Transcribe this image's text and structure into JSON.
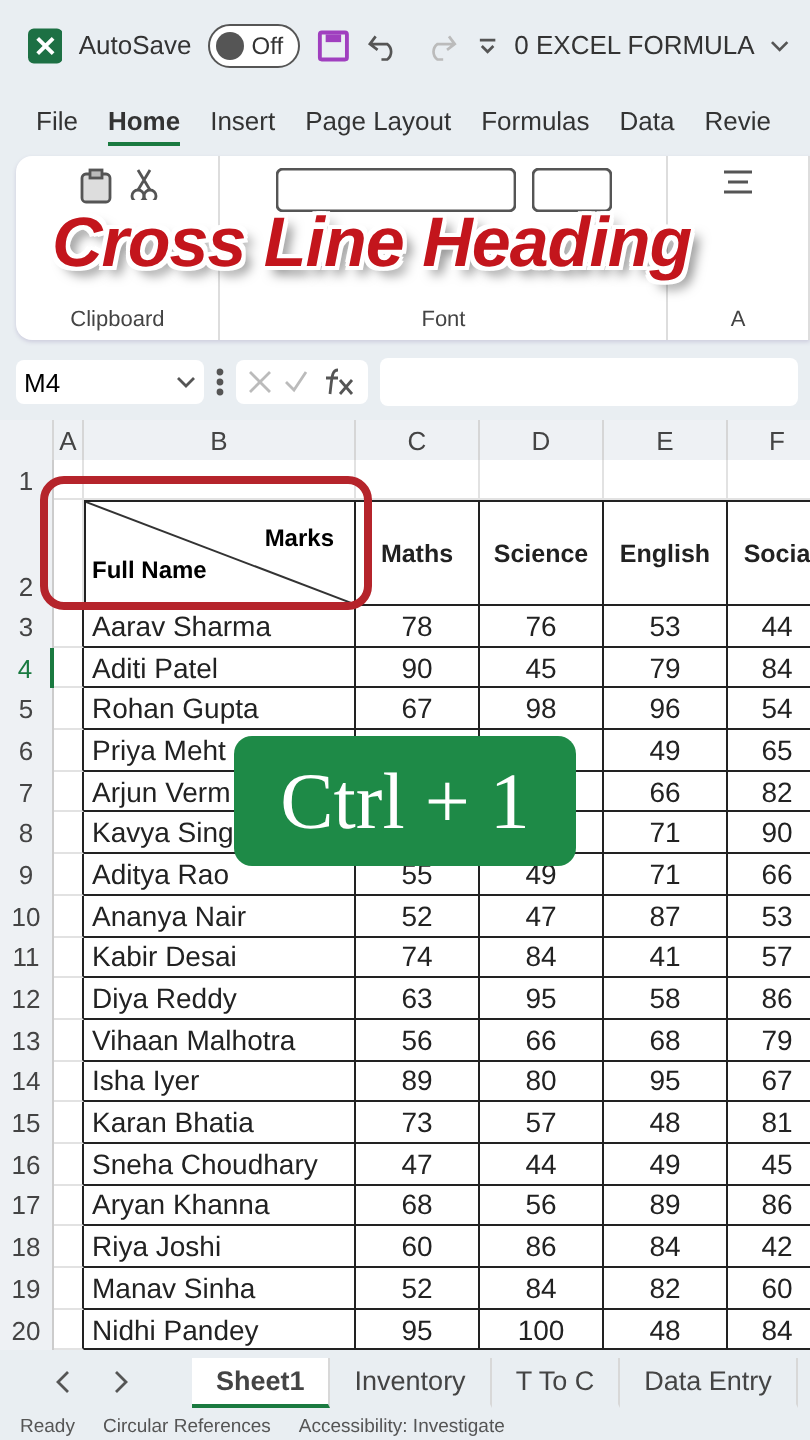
{
  "title_bar": {
    "autosave_label": "AutoSave",
    "autosave": {
      "on": false,
      "label": "Off"
    },
    "document_title": "0 EXCEL FORMULA"
  },
  "ribbon_tabs": [
    {
      "label": "File",
      "selected": false
    },
    {
      "label": "Home",
      "selected": true
    },
    {
      "label": "Insert",
      "selected": false
    },
    {
      "label": "Page Layout",
      "selected": false
    },
    {
      "label": "Formulas",
      "selected": false
    },
    {
      "label": "Data",
      "selected": false
    },
    {
      "label": "Revie",
      "selected": false
    }
  ],
  "ribbon_groups": [
    {
      "kind": "clipboard",
      "label": "Clipboard"
    },
    {
      "kind": "font",
      "label": "Font"
    },
    {
      "kind": "alignment",
      "label": "A"
    }
  ],
  "overlay_title": "Cross Line Heading",
  "formula_bar": {
    "name_box": "M4"
  },
  "sheet": {
    "columns": [
      "A",
      "B",
      "C",
      "D",
      "E",
      "F"
    ],
    "blank_row": {
      "number": "1"
    },
    "header_row": {
      "number": "2",
      "diagonal_top": "Marks",
      "diagonal_bottom": "Full Name",
      "subjects": [
        "Maths",
        "Science",
        "English",
        "Socia"
      ]
    },
    "rows": [
      {
        "number": "3",
        "selected": false,
        "name": "Aarav Sharma",
        "marks": [
          "78",
          "76",
          "53",
          "44"
        ]
      },
      {
        "number": "4",
        "selected": true,
        "name": "Aditi Patel",
        "marks": [
          "90",
          "45",
          "79",
          "84"
        ]
      },
      {
        "number": "5",
        "selected": false,
        "name": "Rohan Gupta",
        "marks": [
          "67",
          "98",
          "96",
          "54"
        ]
      },
      {
        "number": "6",
        "selected": false,
        "name": "Priya Meht",
        "marks": [
          "49",
          "65"
        ]
      },
      {
        "number": "7",
        "selected": false,
        "name": "Arjun Verm",
        "marks": [
          "66",
          "82"
        ]
      },
      {
        "number": "8",
        "selected": false,
        "name": "Kavya Sing",
        "marks": [
          "71",
          "90"
        ]
      },
      {
        "number": "9",
        "selected": false,
        "name": "Aditya Rao",
        "marks": [
          "55",
          "49",
          "71",
          "66"
        ]
      },
      {
        "number": "10",
        "selected": false,
        "name": "Ananya Nair",
        "marks": [
          "52",
          "47",
          "87",
          "53"
        ]
      },
      {
        "number": "11",
        "selected": false,
        "name": "Kabir Desai",
        "marks": [
          "74",
          "84",
          "41",
          "57"
        ]
      },
      {
        "number": "12",
        "selected": false,
        "name": "Diya Reddy",
        "marks": [
          "63",
          "95",
          "58",
          "86"
        ]
      },
      {
        "number": "13",
        "selected": false,
        "name": "Vihaan Malhotra",
        "marks": [
          "56",
          "66",
          "68",
          "79"
        ]
      },
      {
        "number": "14",
        "selected": false,
        "name": "Isha Iyer",
        "marks": [
          "89",
          "80",
          "95",
          "67"
        ]
      },
      {
        "number": "15",
        "selected": false,
        "name": "Karan Bhatia",
        "marks": [
          "73",
          "57",
          "48",
          "81"
        ]
      },
      {
        "number": "16",
        "selected": false,
        "name": "Sneha Choudhary",
        "marks": [
          "47",
          "44",
          "49",
          "45"
        ]
      },
      {
        "number": "17",
        "selected": false,
        "name": "Aryan Khanna",
        "marks": [
          "68",
          "56",
          "89",
          "86"
        ]
      },
      {
        "number": "18",
        "selected": false,
        "name": "Riya Joshi",
        "marks": [
          "60",
          "86",
          "84",
          "42"
        ]
      },
      {
        "number": "19",
        "selected": false,
        "name": "Manav Sinha",
        "marks": [
          "52",
          "84",
          "82",
          "60"
        ]
      },
      {
        "number": "20",
        "selected": false,
        "name": "Nidhi Pandey",
        "marks": [
          "95",
          "100",
          "48",
          "84"
        ]
      }
    ]
  },
  "shortcut_badge": "Ctrl + 1",
  "sheet_tabs": [
    {
      "label": "Sheet1",
      "selected": true
    },
    {
      "label": "Inventory",
      "selected": false
    },
    {
      "label": "T To C",
      "selected": false
    },
    {
      "label": "Data Entry",
      "selected": false
    }
  ],
  "status_bar": [
    "Ready",
    "Circular References",
    "Accessibility: Investigate"
  ]
}
